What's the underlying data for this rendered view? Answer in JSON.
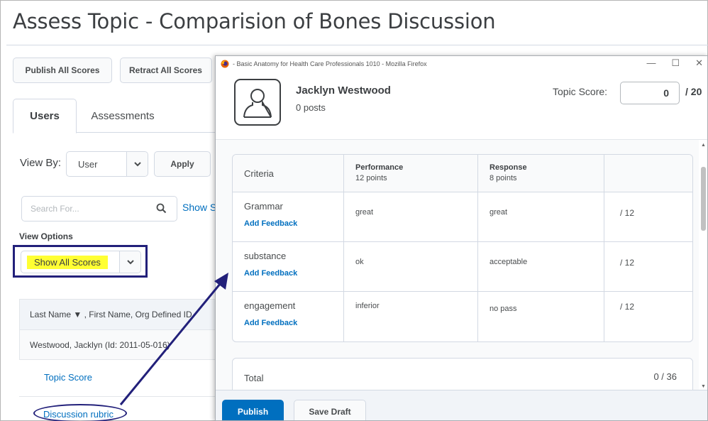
{
  "page": {
    "title": "Assess Topic - Comparision of Bones Discussion",
    "publish_all": "Publish All Scores",
    "retract_all": "Retract All Scores",
    "tabs": [
      "Users",
      "Assessments"
    ],
    "view_by_label": "View By:",
    "view_by_value": "User",
    "apply": "Apply",
    "search_placeholder": "Search For...",
    "show_search": "Show S",
    "view_options_label": "View Options",
    "scores_filter": "Show All Scores",
    "list_header": "Last Name ▼ , First Name, Org Defined ID",
    "list_row": "Westwood, Jacklyn (Id: 2011-05-016)",
    "topic_score_link": "Topic Score",
    "rubric_link": "Discussion rubric"
  },
  "popup": {
    "window_title": "- Basic Anatomy for Health Care Professionals 1010 - Mozilla Firefox",
    "user_name": "Jacklyn Westwood",
    "posts": "0 posts",
    "topic_score_label": "Topic Score:",
    "topic_score_value": "0",
    "topic_score_out_of": "/ 20",
    "rubric": {
      "criteria_header": "Criteria",
      "levels": [
        {
          "name": "Performance",
          "points": "12 points"
        },
        {
          "name": "Response",
          "points": "8 points"
        }
      ],
      "rows": [
        {
          "criterion": "Grammar",
          "add_feedback": "Add Feedback",
          "performance": "great",
          "response": "great",
          "score": "/ 12"
        },
        {
          "criterion": "substance",
          "add_feedback": "Add Feedback",
          "performance": "ok",
          "response": "acceptable",
          "score": "/ 12"
        },
        {
          "criterion": "engagement",
          "add_feedback": "Add Feedback",
          "performance": "inferior",
          "response": "no pass",
          "score": "/ 12"
        }
      ]
    },
    "total_label": "Total",
    "total_value": "0 / 36",
    "publish": "Publish",
    "save_draft": "Save Draft"
  },
  "colors": {
    "link": "#006fbf",
    "annotation": "#22207a",
    "highlight": "#ffff33",
    "primary_button": "#006fbf"
  }
}
